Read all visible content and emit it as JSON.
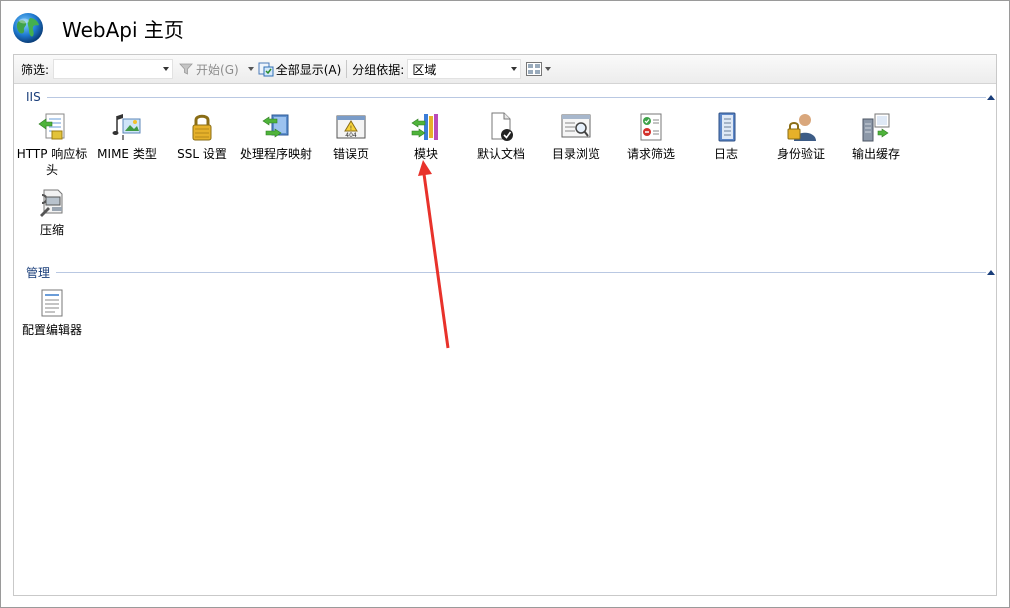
{
  "header": {
    "title": "WebApi 主页"
  },
  "toolbar": {
    "filter_label": "筛选:",
    "filter_value": "",
    "start_label": "开始(G)",
    "show_all_label": "全部显示(A)",
    "group_by_label": "分组依据:",
    "group_by_value": "区域"
  },
  "groups": [
    {
      "title": "IIS",
      "items": [
        {
          "label": "HTTP 响应标头",
          "icon": "http-response-headers-icon"
        },
        {
          "label": "MIME 类型",
          "icon": "mime-types-icon"
        },
        {
          "label": "SSL 设置",
          "icon": "ssl-lock-icon"
        },
        {
          "label": "处理程序映射",
          "icon": "handler-mappings-icon"
        },
        {
          "label": "错误页",
          "icon": "error-pages-icon"
        },
        {
          "label": "模块",
          "icon": "modules-icon"
        },
        {
          "label": "默认文档",
          "icon": "default-document-icon"
        },
        {
          "label": "目录浏览",
          "icon": "directory-browsing-icon"
        },
        {
          "label": "请求筛选",
          "icon": "request-filtering-icon"
        },
        {
          "label": "日志",
          "icon": "logging-icon"
        },
        {
          "label": "身份验证",
          "icon": "authentication-icon"
        },
        {
          "label": "输出缓存",
          "icon": "output-caching-icon"
        },
        {
          "label": "压缩",
          "icon": "compression-icon"
        }
      ]
    },
    {
      "title": "管理",
      "items": [
        {
          "label": "配置编辑器",
          "icon": "configuration-editor-icon"
        }
      ]
    }
  ],
  "colors": {
    "group_title": "#1a3e7a",
    "annotation_arrow": "#e8322b"
  }
}
